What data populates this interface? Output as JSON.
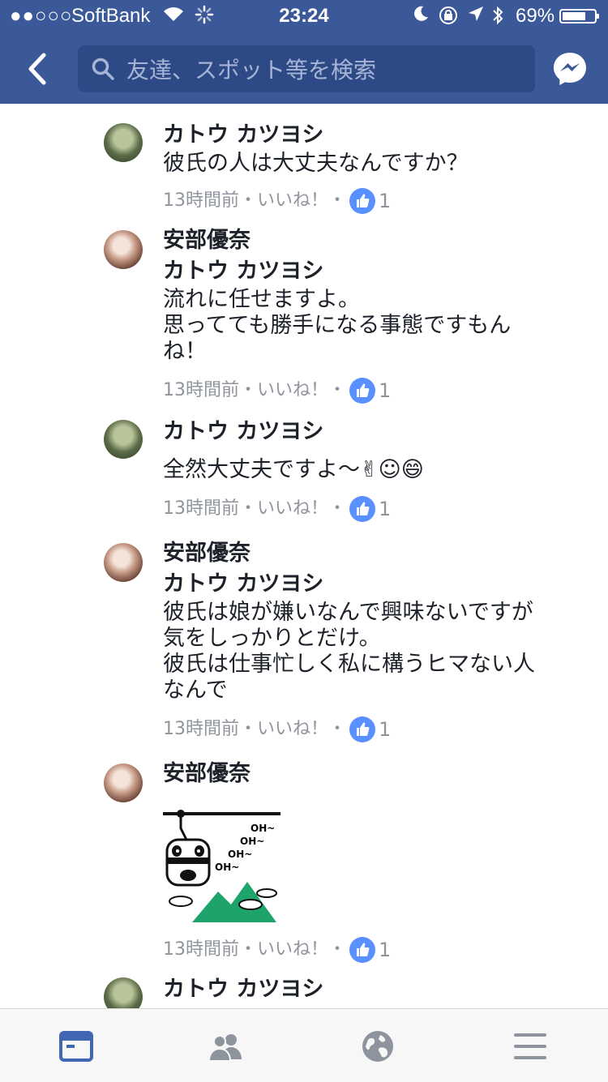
{
  "status_bar": {
    "signal": "●●○○○",
    "carrier": "SoftBank",
    "time": "23:24",
    "battery": "69%",
    "battery_level": 0.69
  },
  "search": {
    "placeholder": "友達、スポット等を検索"
  },
  "comments": [
    {
      "name": "カトウ カツヨシ",
      "reply_to": "",
      "lines": [
        "彼氏の人は大丈夫なんですか？"
      ],
      "time": "13時間前・いいね！・",
      "likes": "1"
    },
    {
      "name": "安部優奈",
      "reply_to": "カトウ カツヨシ",
      "lines": [
        "流れに任せますよ。",
        "思ってても勝手になる事態ですもん",
        "ね！"
      ],
      "time": "13時間前・いいね！・",
      "likes": "1"
    },
    {
      "name": "カトウ カツヨシ",
      "reply_to": "",
      "lines": [
        "全然大丈夫ですよ〜✌☺😄"
      ],
      "time": "13時間前・いいね！・",
      "likes": "1"
    },
    {
      "name": "安部優奈",
      "reply_to": "カトウ カツヨシ",
      "lines": [
        "彼氏は娘が嫌いなんで興味ないですが",
        "気をしっかりとだけ。",
        "彼氏は仕事忙しく私に構うヒマない人",
        "なんで"
      ],
      "time": "13時間前・いいね！・",
      "likes": "1"
    },
    {
      "name": "安部優奈",
      "reply_to": "",
      "sticker_text": [
        "OH~",
        "OH~",
        "OH~",
        "OH~"
      ],
      "time": "13時間前・いいね！・",
      "likes": "1"
    },
    {
      "name": "カトウ カツヨシ",
      "reply_to": "",
      "lines": [],
      "time": "",
      "likes": ""
    }
  ],
  "colors": {
    "header": "#3b5998",
    "like": "#5890ff",
    "meta": "#90949c",
    "tab_active": "#4267b2",
    "tab_inactive": "#8d949e"
  },
  "tabs": [
    {
      "icon": "news-feed-icon",
      "active": true
    },
    {
      "icon": "friends-icon",
      "active": false
    },
    {
      "icon": "globe-icon",
      "active": false
    },
    {
      "icon": "menu-icon",
      "active": false
    }
  ]
}
